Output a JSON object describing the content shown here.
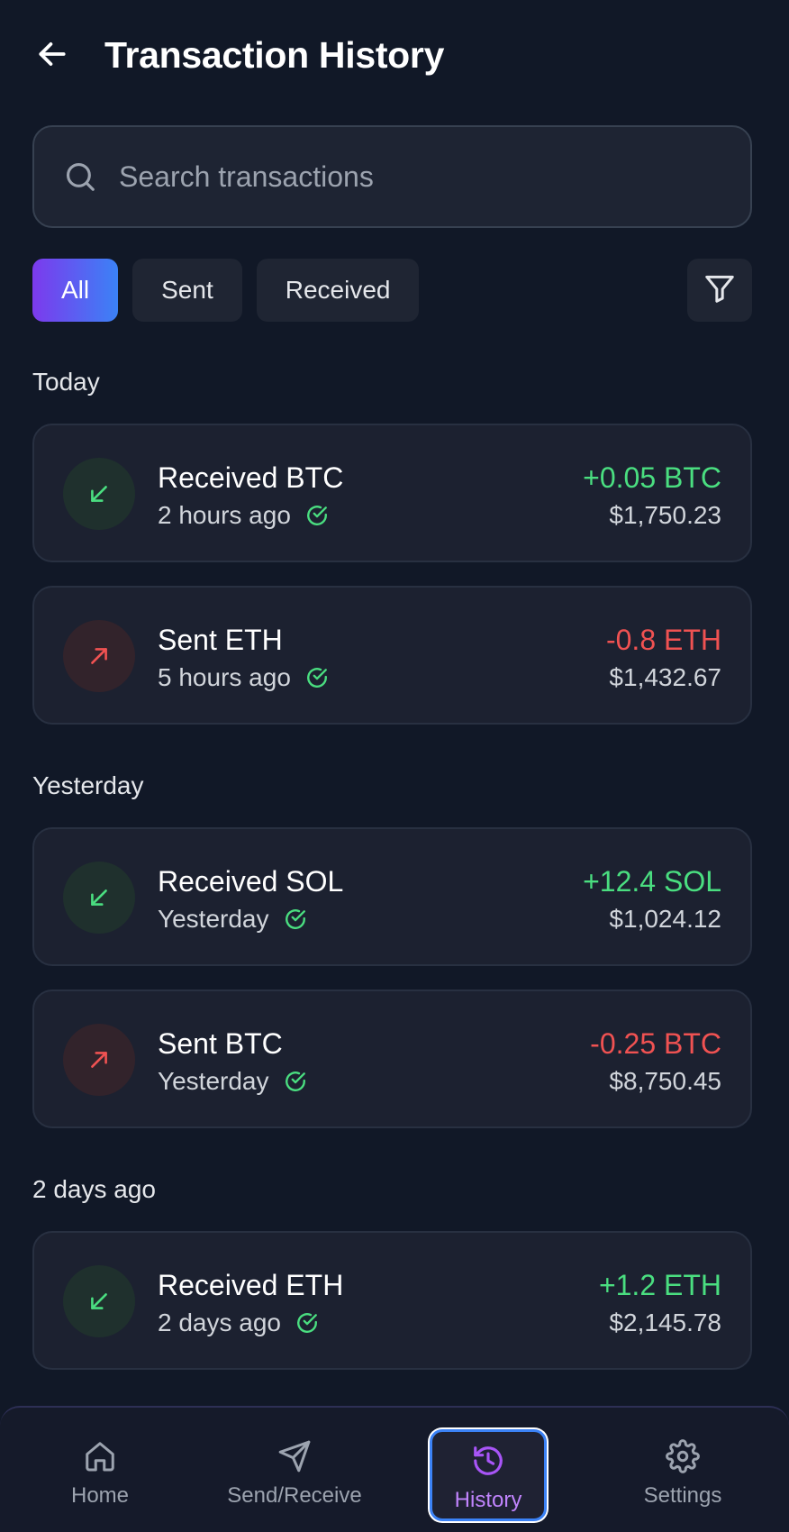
{
  "header": {
    "title": "Transaction History",
    "back_icon": "arrow-left-icon"
  },
  "search": {
    "placeholder": "Search transactions",
    "value": ""
  },
  "filters": {
    "chips": [
      {
        "label": "All",
        "active": true
      },
      {
        "label": "Sent",
        "active": false
      },
      {
        "label": "Received",
        "active": false
      }
    ],
    "filter_icon": "funnel-icon"
  },
  "sections": [
    {
      "label": "Today",
      "transactions": [
        {
          "direction": "received",
          "title": "Received BTC",
          "time": "2 hours ago",
          "amount": "+0.05 BTC",
          "fiat": "$1,750.23",
          "status": "confirmed"
        },
        {
          "direction": "sent",
          "title": "Sent ETH",
          "time": "5 hours ago",
          "amount": "-0.8 ETH",
          "fiat": "$1,432.67",
          "status": "confirmed"
        }
      ]
    },
    {
      "label": "Yesterday",
      "transactions": [
        {
          "direction": "received",
          "title": "Received SOL",
          "time": "Yesterday",
          "amount": "+12.4 SOL",
          "fiat": "$1,024.12",
          "status": "confirmed"
        },
        {
          "direction": "sent",
          "title": "Sent BTC",
          "time": "Yesterday",
          "amount": "-0.25 BTC",
          "fiat": "$8,750.45",
          "status": "confirmed"
        }
      ]
    },
    {
      "label": "2 days ago",
      "transactions": [
        {
          "direction": "received",
          "title": "Received ETH",
          "time": "2 days ago",
          "amount": "+1.2 ETH",
          "fiat": "$2,145.78",
          "status": "confirmed"
        }
      ]
    }
  ],
  "bottom_nav": {
    "items": [
      {
        "label": "Home",
        "icon": "home-icon",
        "active": false
      },
      {
        "label": "Send/Receive",
        "icon": "send-icon",
        "active": false
      },
      {
        "label": "History",
        "icon": "history-icon",
        "active": true
      },
      {
        "label": "Settings",
        "icon": "gear-icon",
        "active": false
      }
    ]
  },
  "colors": {
    "background": "#111827",
    "card": "#1c2130",
    "positive": "#4ade80",
    "negative": "#f05252",
    "accent_start": "#7c3aed",
    "accent_end": "#3b82f6",
    "active_nav_label": "#c084fc"
  }
}
